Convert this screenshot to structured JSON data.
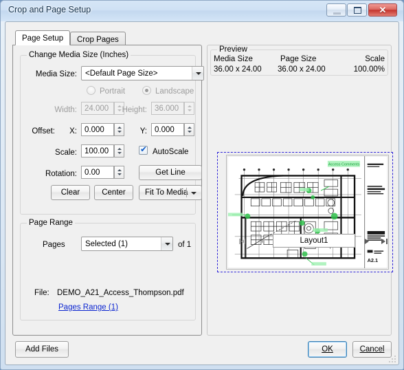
{
  "window": {
    "title": "Crop and Page Setup",
    "minimize_tooltip": "Minimize",
    "maximize_tooltip": "Restore",
    "close_tooltip": "Close",
    "close_glyph": "✕"
  },
  "tabs": [
    {
      "label": "Page Setup",
      "active": true
    },
    {
      "label": "Crop Pages",
      "active": false
    }
  ],
  "media_group": {
    "title": "Change Media Size (Inches)",
    "media_size_label": "Media Size:",
    "media_size_value": "<Default Page Size>",
    "orientation": {
      "portrait_label": "Portrait",
      "landscape_label": "Landscape",
      "selected": "Landscape"
    },
    "width_label": "Width:",
    "width_value": "24.000",
    "height_label": "Height:",
    "height_value": "36.000",
    "offset_label": "Offset:",
    "offset_x_label": "X:",
    "offset_x_value": "0.000",
    "offset_y_label": "Y:",
    "offset_y_value": "0.000",
    "scale_label": "Scale:",
    "scale_value": "100.00",
    "autoscale_label": "AutoScale",
    "autoscale_checked": true,
    "rotation_label": "Rotation:",
    "rotation_value": "0.00",
    "get_line_label": "Get Line",
    "clear_label": "Clear",
    "center_label": "Center",
    "fit_to_media_label": "Fit To Media"
  },
  "page_range": {
    "title": "Page Range",
    "pages_label": "Pages",
    "pages_value": "Selected (1)",
    "of_label": "of 1",
    "file_label": "File:",
    "file_name": "DEMO_A21_Access_Thompson.pdf",
    "pages_range_link": "Pages Range (1)"
  },
  "preview": {
    "title": "Preview",
    "media_size_header": "Media Size",
    "media_size_value": "36.00 x 24.00",
    "page_size_header": "Page Size",
    "page_size_value": "36.00 x 24.00",
    "scale_header": "Scale",
    "scale_value": "100.00%",
    "layout_name": "Layout1",
    "nav_first": "⏮",
    "nav_prev": "◀",
    "nav_next": "▶",
    "nav_last": "⏭",
    "drawing": {
      "markup_text": "Access Comments",
      "sheet_number": "A2.1",
      "markup_color": "#31c24d",
      "border_color": "#2a1fd8"
    }
  },
  "footer": {
    "add_files_label": "Add Files",
    "ok_label": "OK",
    "ok_accel": "O",
    "cancel_label": "Cancel",
    "cancel_accel": "C"
  },
  "colors": {
    "dialog_face": "#f0f0f0",
    "accent_blue": "#3c7fb1",
    "link_blue": "#0a24d0",
    "close_red": "#c4342e",
    "markup_green": "#31c24d"
  }
}
